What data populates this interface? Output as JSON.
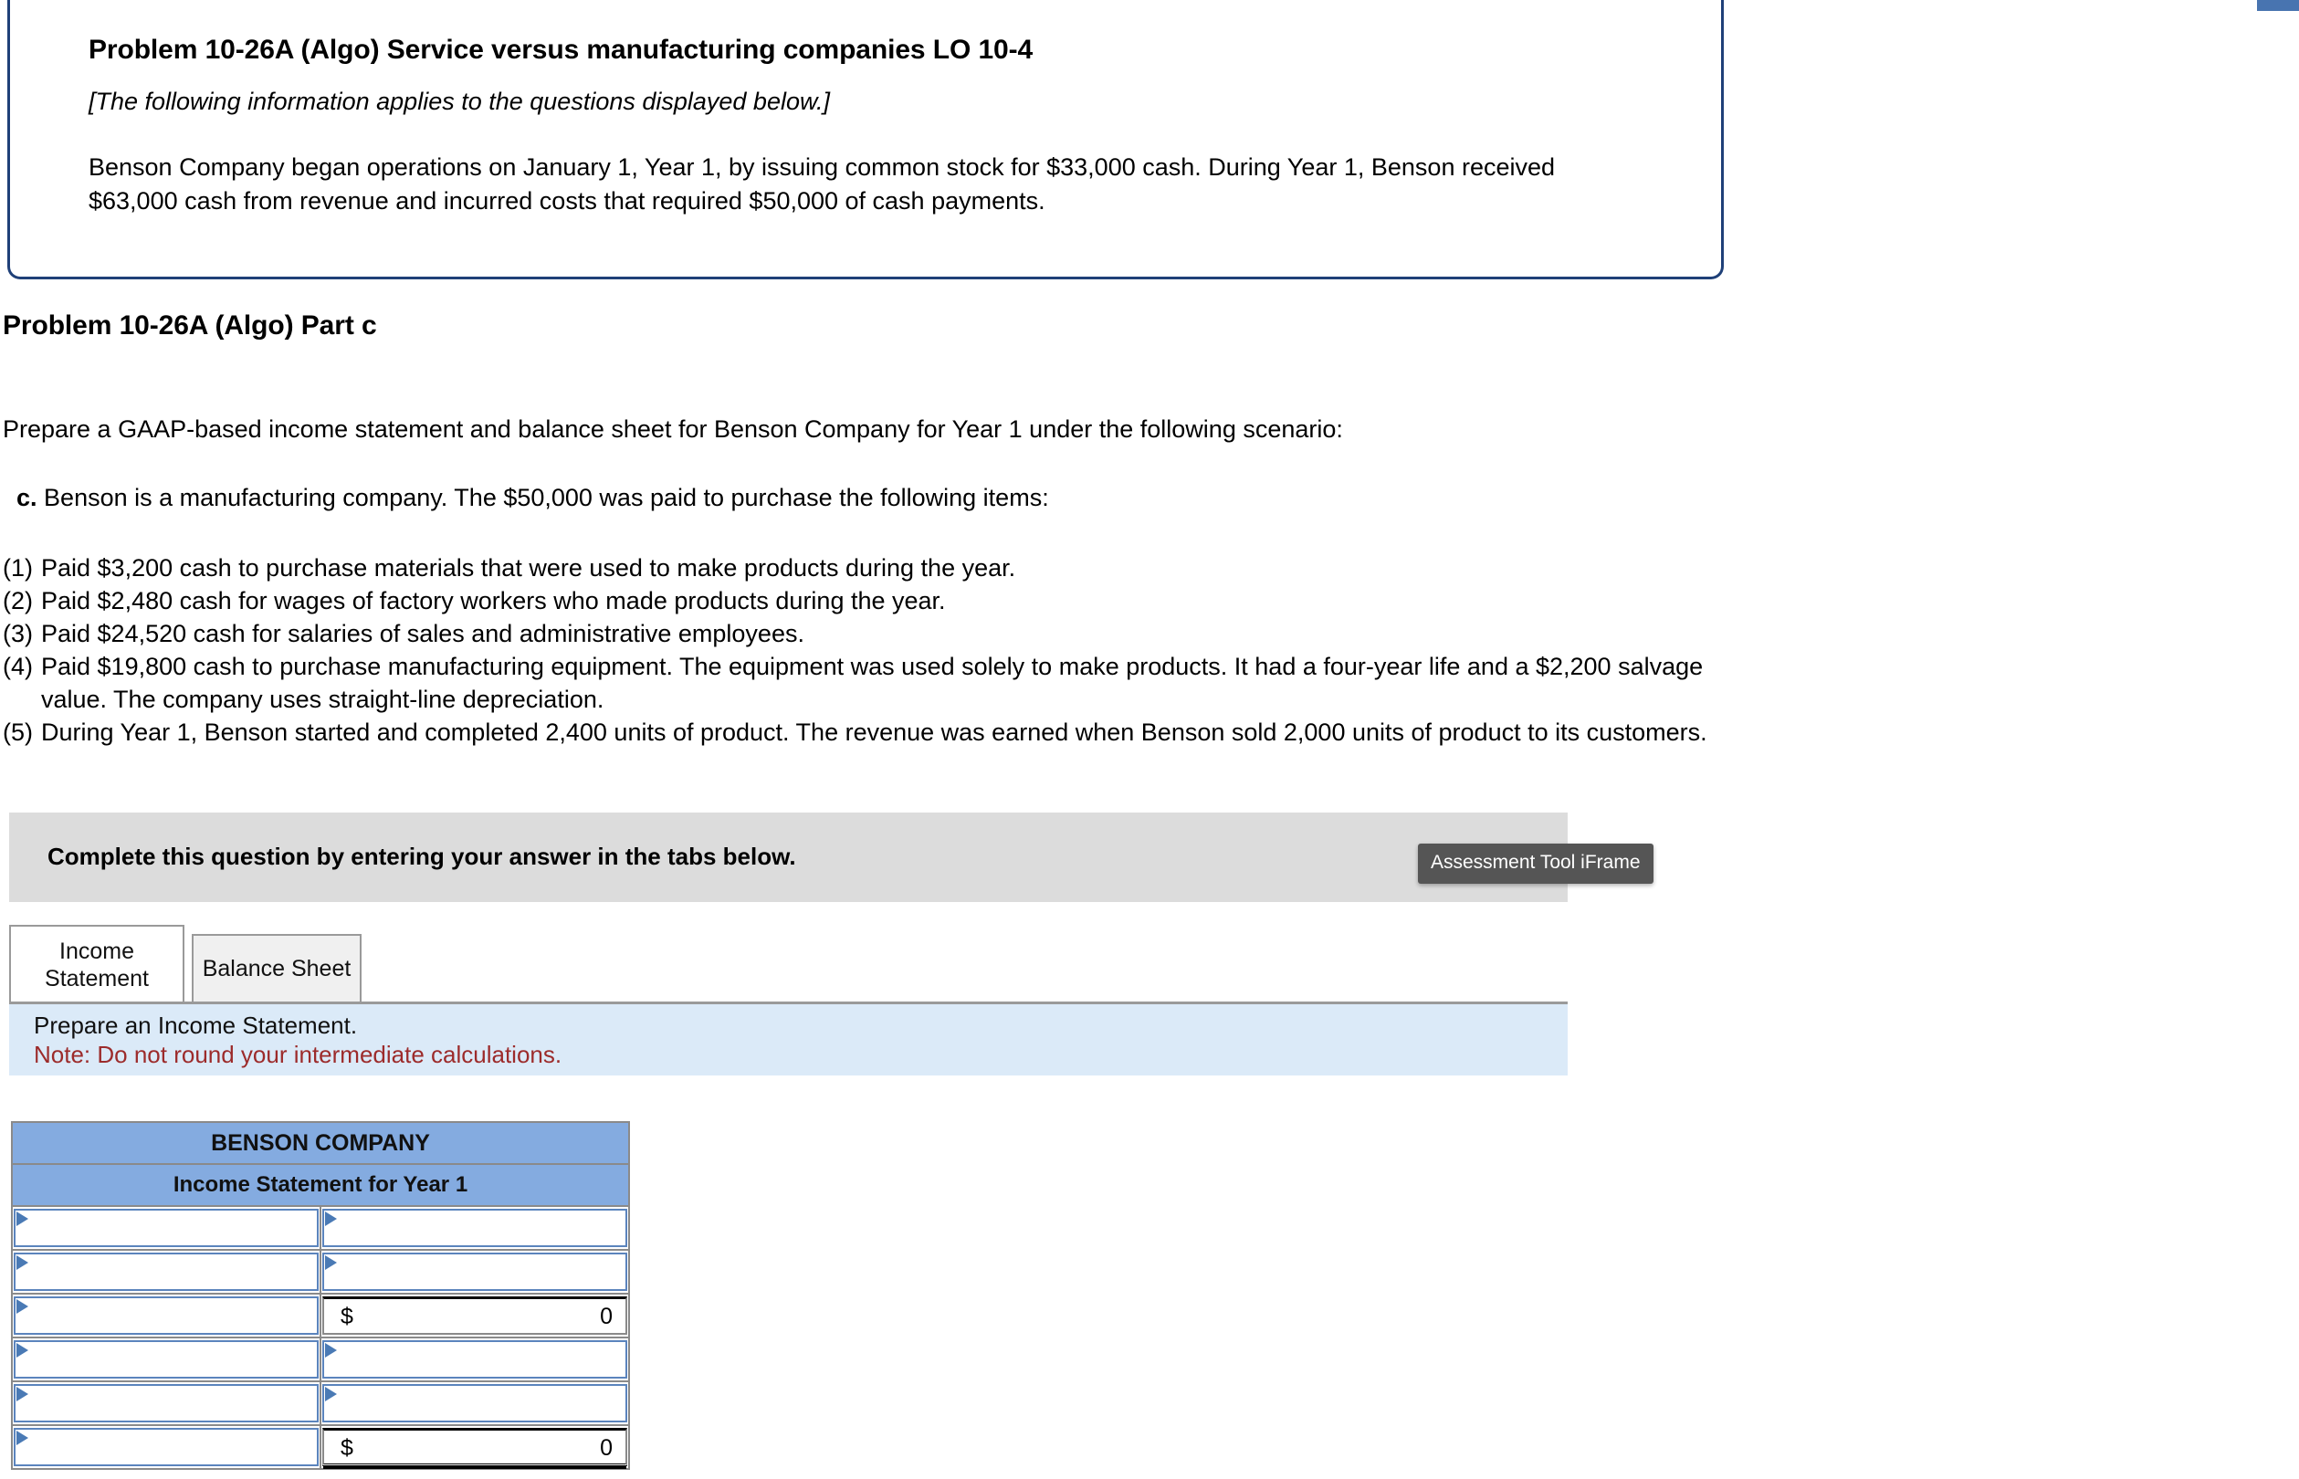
{
  "info_box": {
    "problem_title": "Problem 10-26A (Algo) Service versus manufacturing companies LO 10-4",
    "applies_note": "[The following information applies to the questions displayed below.]",
    "scenario": "Benson Company began operations on January 1, Year 1, by issuing common stock for $33,000 cash. During Year 1, Benson received $63,000 cash from revenue and incurred costs that required $50,000 of cash payments."
  },
  "part": {
    "heading": "Problem 10-26A (Algo) Part c",
    "prepare_line": "Prepare a GAAP-based income statement and balance sheet for Benson Company for Year 1 under the following scenario:",
    "scenario_label": "c.",
    "scenario_text": "Benson is a manufacturing company. The $50,000 was paid to purchase the following items:"
  },
  "items": [
    {
      "num": "(1)",
      "text": "Paid $3,200 cash to purchase materials that were used to make products during the year."
    },
    {
      "num": "(2)",
      "text": "Paid $2,480 cash for wages of factory workers who made products during the year."
    },
    {
      "num": "(3)",
      "text": "Paid $24,520 cash for salaries of sales and administrative employees."
    },
    {
      "num": "(4)",
      "text": "Paid $19,800 cash to purchase manufacturing equipment. The equipment was used solely to make products. It had a four-year life and a $2,200 salvage value. The company uses straight-line depreciation."
    },
    {
      "num": "(5)",
      "text": "During Year 1, Benson started and completed 2,400 units of product. The revenue was earned when Benson sold 2,000 units of product to its customers."
    }
  ],
  "complete_bar": {
    "text": "Complete this question by entering your answer in the tabs below."
  },
  "tooltip": {
    "label": "Assessment Tool iFrame"
  },
  "tabs": [
    {
      "label_line1": "Income",
      "label_line2": "Statement",
      "active": true
    },
    {
      "label": "Balance Sheet",
      "active": false
    }
  ],
  "instructions": {
    "line1": "Prepare an Income Statement.",
    "line2": "Note: Do not round your intermediate calculations."
  },
  "income_statement": {
    "company": "BENSON COMPANY",
    "subtitle": "Income Statement for Year 1",
    "rows": [
      {
        "label": "",
        "value_dollar": "",
        "value_amount": "",
        "label_dropdown": true,
        "value_dropdown": true,
        "value_total": false
      },
      {
        "label": "",
        "value_dollar": "",
        "value_amount": "",
        "label_dropdown": true,
        "value_dropdown": true,
        "value_total": false
      },
      {
        "label": "",
        "value_dollar": "$",
        "value_amount": "0",
        "label_dropdown": true,
        "value_dropdown": false,
        "value_total": false
      },
      {
        "label": "",
        "value_dollar": "",
        "value_amount": "",
        "label_dropdown": true,
        "value_dropdown": true,
        "value_total": false
      },
      {
        "label": "",
        "value_dollar": "",
        "value_amount": "",
        "label_dropdown": true,
        "value_dropdown": true,
        "value_total": false
      },
      {
        "label": "",
        "value_dollar": "$",
        "value_amount": "0",
        "label_dropdown": true,
        "value_dropdown": false,
        "value_total": true
      }
    ]
  },
  "colors": {
    "info_border": "#1f4078",
    "header_blue": "#84abe0",
    "note_red": "#9c2b2b",
    "panel_blue": "#dbeaf8",
    "bar_gray": "#dcdcdc",
    "tooltip_gray": "#555555",
    "triangle_blue": "#4a7ab5"
  }
}
